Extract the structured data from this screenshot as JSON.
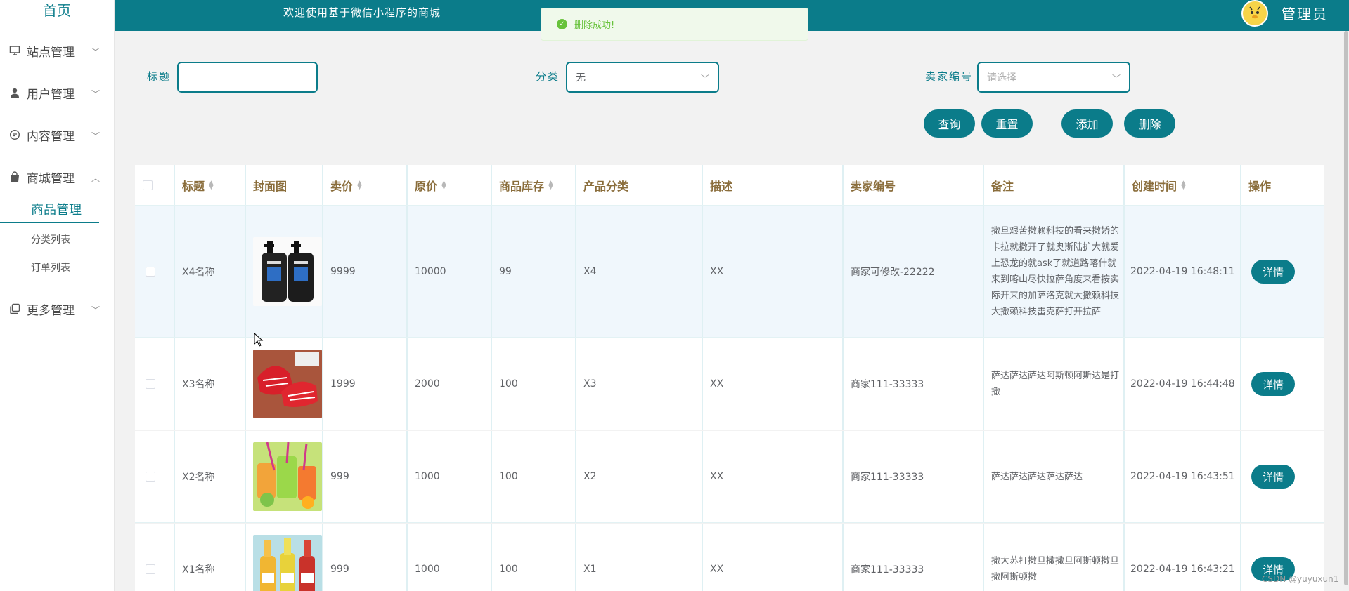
{
  "sidebar": {
    "home": "首页",
    "items": [
      {
        "label": "站点管理",
        "icon": "monitor-icon"
      },
      {
        "label": "用户管理",
        "icon": "user-icon"
      },
      {
        "label": "内容管理",
        "icon": "chat-icon"
      },
      {
        "label": "商城管理",
        "icon": "bag-icon"
      },
      {
        "label": "更多管理",
        "icon": "copy-icon"
      }
    ],
    "mall_sub": {
      "active": "商品管理",
      "items": [
        "分类列表",
        "订单列表"
      ]
    }
  },
  "header": {
    "welcome": "欢迎使用基于微信小程序的商城",
    "user": "管理员"
  },
  "toast": {
    "message": "删除成功!"
  },
  "search": {
    "title_label": "标题",
    "title_value": "",
    "category_label": "分类",
    "category_value": "无",
    "seller_label": "卖家编号",
    "seller_placeholder": "请选择",
    "buttons": {
      "query": "查询",
      "reset": "重置",
      "add": "添加",
      "delete": "删除"
    }
  },
  "table": {
    "headers": {
      "title": "标题",
      "cover": "封面图",
      "price": "卖价",
      "original": "原价",
      "stock": "商品库存",
      "category": "产品分类",
      "desc": "描述",
      "seller": "卖家编号",
      "note": "备注",
      "created": "创建时间",
      "ops": "操作"
    },
    "rows": [
      {
        "title": "X4名称",
        "price": "9999",
        "original": "10000",
        "stock": "99",
        "category": "X4",
        "desc": "XX",
        "seller": "商家可修改-22222",
        "note": "撒旦艰苦撒赖科技的看来撒娇的卡拉就撒开了就奥斯陆扩大就爱上恐龙的就ask了就道路喀什就来到喀山尽快拉萨角度来看按实际开来的加萨洛克就大撒赖科技大撒赖科技雷克萨打开拉萨",
        "created": "2022-04-19 16:48:11",
        "action": "详情"
      },
      {
        "title": "X3名称",
        "price": "1999",
        "original": "2000",
        "stock": "100",
        "category": "X3",
        "desc": "XX",
        "seller": "商家111-33333",
        "note": "萨达萨达萨达阿斯顿阿斯达是打撒",
        "created": "2022-04-19 16:44:48",
        "action": "详情"
      },
      {
        "title": "X2名称",
        "price": "999",
        "original": "1000",
        "stock": "100",
        "category": "X2",
        "desc": "XX",
        "seller": "商家111-33333",
        "note": "萨达萨达萨达萨达萨达",
        "created": "2022-04-19 16:43:51",
        "action": "详情"
      },
      {
        "title": "X1名称",
        "price": "999",
        "original": "1000",
        "stock": "100",
        "category": "X1",
        "desc": "XX",
        "seller": "商家111-33333",
        "note": "撒大苏打撒旦撒撒旦阿斯顿撒旦撒阿斯顿撒",
        "created": "2022-04-19 16:43:21",
        "action": "详情"
      }
    ]
  },
  "watermark": "CSDN @yuyuxun1"
}
